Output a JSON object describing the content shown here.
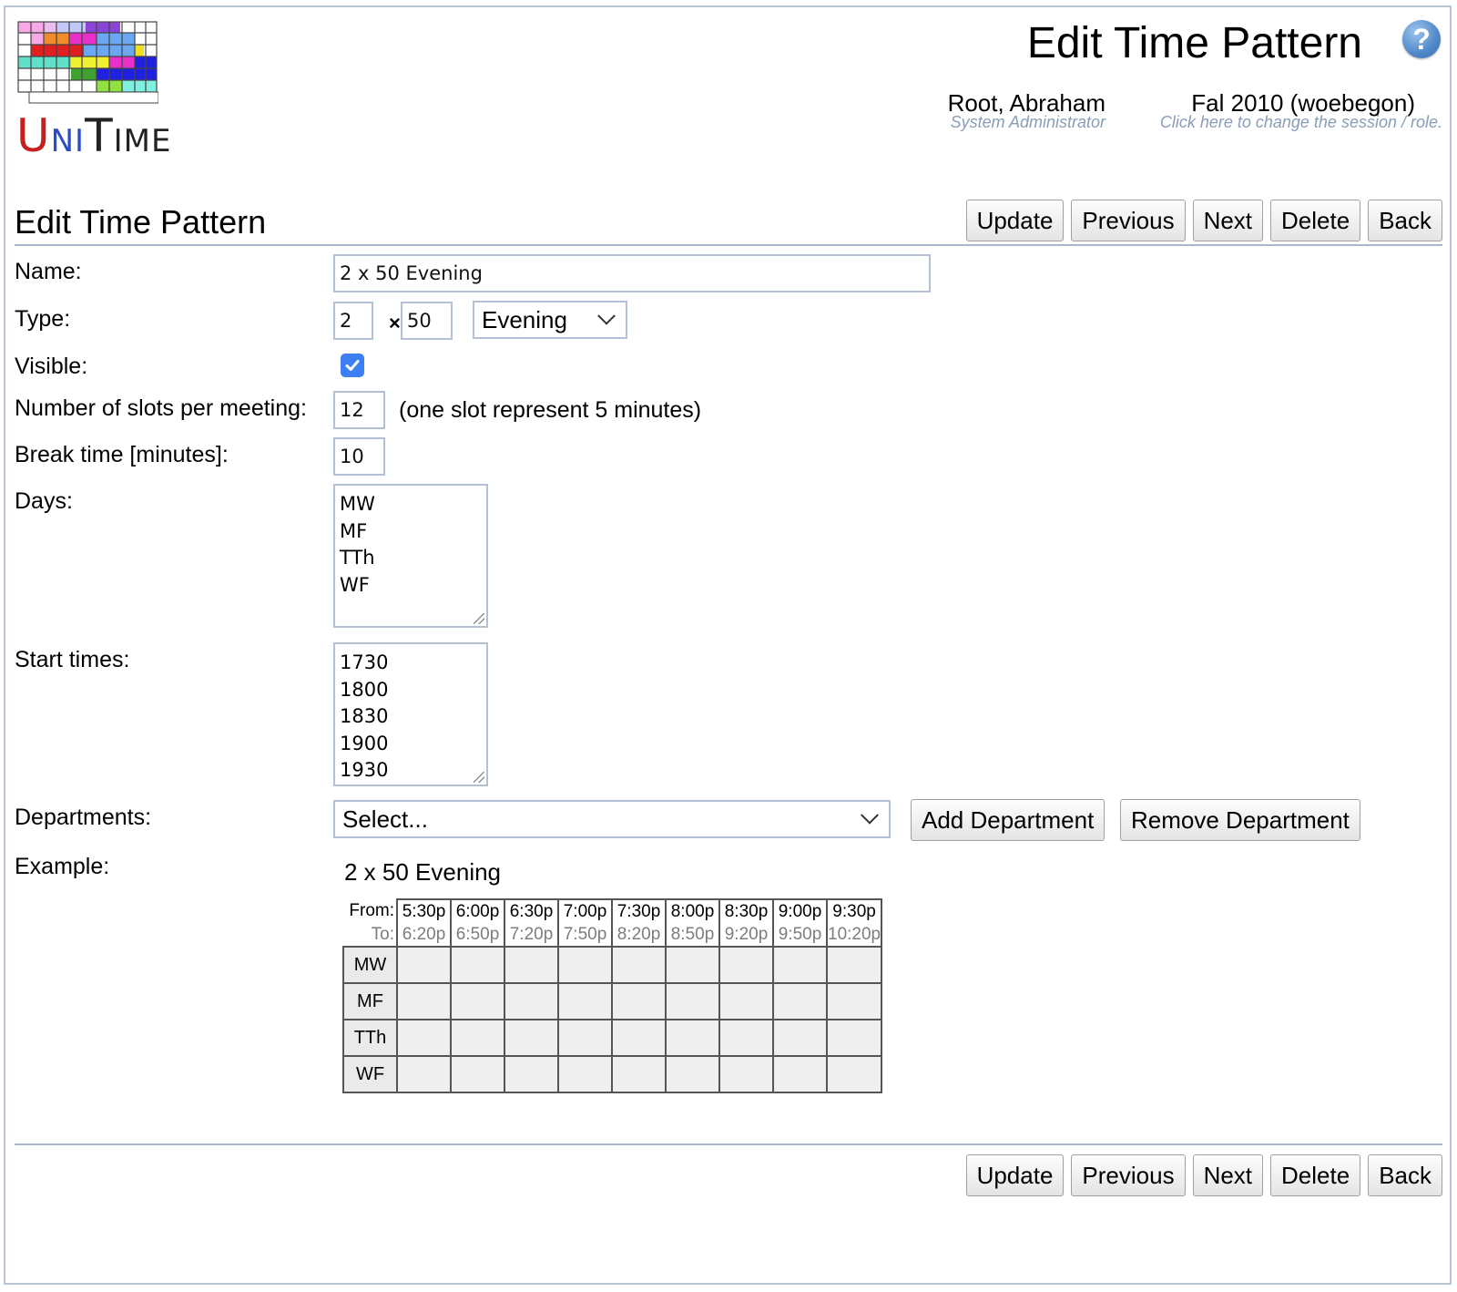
{
  "logo": {
    "text_parts": [
      "U",
      "NI",
      "T",
      "IME"
    ]
  },
  "header": {
    "title": "Edit Time Pattern",
    "help_icon": "question-mark-icon",
    "user": {
      "name": "Root, Abraham",
      "role": "System Administrator"
    },
    "session": {
      "name": "Fal 2010 (woebegon)",
      "hint": "Click here to change the session / role."
    }
  },
  "section": {
    "title": "Edit Time Pattern"
  },
  "buttons": {
    "update": "Update",
    "previous": "Previous",
    "next": "Next",
    "delete": "Delete",
    "back": "Back"
  },
  "form": {
    "name": {
      "label": "Name:",
      "value": "2 x 50 Evening"
    },
    "type": {
      "label": "Type:",
      "meetings": "2",
      "times_sign": "×",
      "minutes": "50",
      "kind": "Evening"
    },
    "visible": {
      "label": "Visible:",
      "checked": true
    },
    "slots": {
      "label": "Number of slots per meeting:",
      "value": "12",
      "note": "(one slot represent 5 minutes)"
    },
    "break_time": {
      "label": "Break time [minutes]:",
      "value": "10"
    },
    "days": {
      "label": "Days:",
      "values": [
        "MW",
        "MF",
        "TTh",
        "WF"
      ]
    },
    "start_times": {
      "label": "Start times:",
      "values": [
        "1730",
        "1800",
        "1830",
        "1900",
        "1930"
      ]
    },
    "departments": {
      "label": "Departments:",
      "selected": "Select...",
      "add_label": "Add Department",
      "remove_label": "Remove Department"
    },
    "example": {
      "label": "Example:",
      "name": "2 x 50 Evening",
      "from_label": "From:",
      "to_label": "To:",
      "from": [
        "5:30p",
        "6:00p",
        "6:30p",
        "7:00p",
        "7:30p",
        "8:00p",
        "8:30p",
        "9:00p",
        "9:30p"
      ],
      "to": [
        "6:20p",
        "6:50p",
        "7:20p",
        "7:50p",
        "8:20p",
        "8:50p",
        "9:20p",
        "9:50p",
        "10:20p"
      ],
      "rows": [
        "MW",
        "MF",
        "TTh",
        "WF"
      ]
    }
  },
  "colors": {
    "accent": "#3b7ff2",
    "hint": "#8a9db8",
    "border": "#b4c0d4"
  }
}
